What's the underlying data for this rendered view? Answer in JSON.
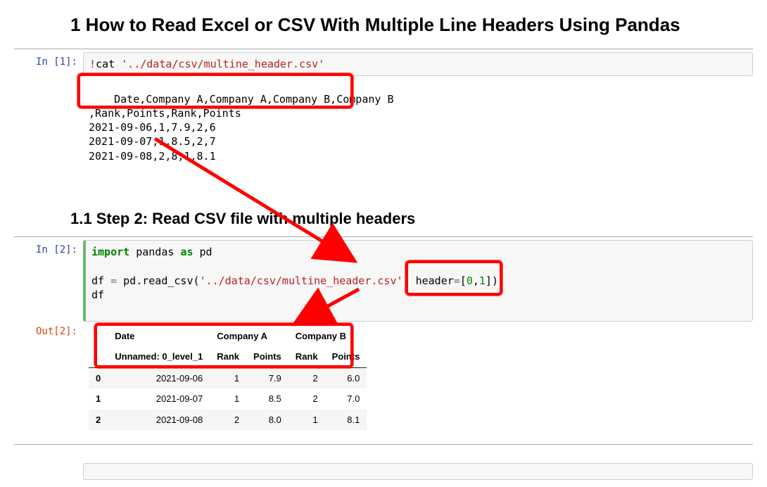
{
  "title": "1  How to Read Excel or CSV With Multiple Line Headers Using Pandas",
  "subtitle": "1.1  Step 2: Read CSV file with multiple headers",
  "prompts": {
    "in1": "In [1]:",
    "in2": "In [2]:",
    "out2": "Out[2]:"
  },
  "cell1": {
    "bang": "!",
    "cmd": "cat ",
    "path": "'../data/csv/multine_header.csv'"
  },
  "cell1_output_lines": [
    "Date,Company A,Company A,Company B,Company B",
    ",Rank,Points,Rank,Points",
    "2021-09-06,1,7.9,2,6",
    "2021-09-07,1,8.5,2,7",
    "2021-09-08,2,8,1,8.1"
  ],
  "cell2": {
    "l1_import": "import",
    "l1_pandas": " pandas ",
    "l1_as": "as",
    "l1_pd": " pd",
    "l2": "",
    "l3_pre": "df ",
    "l3_eq": "=",
    "l3_call": " pd.read_csv(",
    "l3_path": "'../data/csv/multine_header.csv'",
    "l3_comma": ", header",
    "l3_eq2": "=",
    "l3_lb": "[",
    "l3_n0": "0",
    "l3_c": ",",
    "l3_n1": "1",
    "l3_rb": "])",
    "l4": "df"
  },
  "table": {
    "top": [
      "",
      "Date",
      "Company A",
      "",
      "Company B",
      ""
    ],
    "sub": [
      "",
      "Unnamed: 0_level_1",
      "Rank",
      "Points",
      "Rank",
      "Points"
    ],
    "rows": [
      {
        "idx": "0",
        "Date": "2021-09-06",
        "A_Rank": "1",
        "A_Points": "7.9",
        "B_Rank": "2",
        "B_Points": "6.0"
      },
      {
        "idx": "1",
        "Date": "2021-09-07",
        "A_Rank": "1",
        "A_Points": "8.5",
        "B_Rank": "2",
        "B_Points": "7.0"
      },
      {
        "idx": "2",
        "Date": "2021-09-08",
        "A_Rank": "2",
        "A_Points": "8.0",
        "B_Rank": "1",
        "B_Points": "8.1"
      }
    ]
  },
  "chart_data": {
    "type": "table",
    "columns_top": [
      "Date",
      "Company A",
      "Company A",
      "Company B",
      "Company B"
    ],
    "columns_bottom": [
      "Unnamed: 0_level_1",
      "Rank",
      "Points",
      "Rank",
      "Points"
    ],
    "index": [
      0,
      1,
      2
    ],
    "rows": [
      [
        "2021-09-06",
        1,
        7.9,
        2,
        6.0
      ],
      [
        "2021-09-07",
        1,
        8.5,
        2,
        7.0
      ],
      [
        "2021-09-08",
        2,
        8.0,
        1,
        8.1
      ]
    ]
  }
}
